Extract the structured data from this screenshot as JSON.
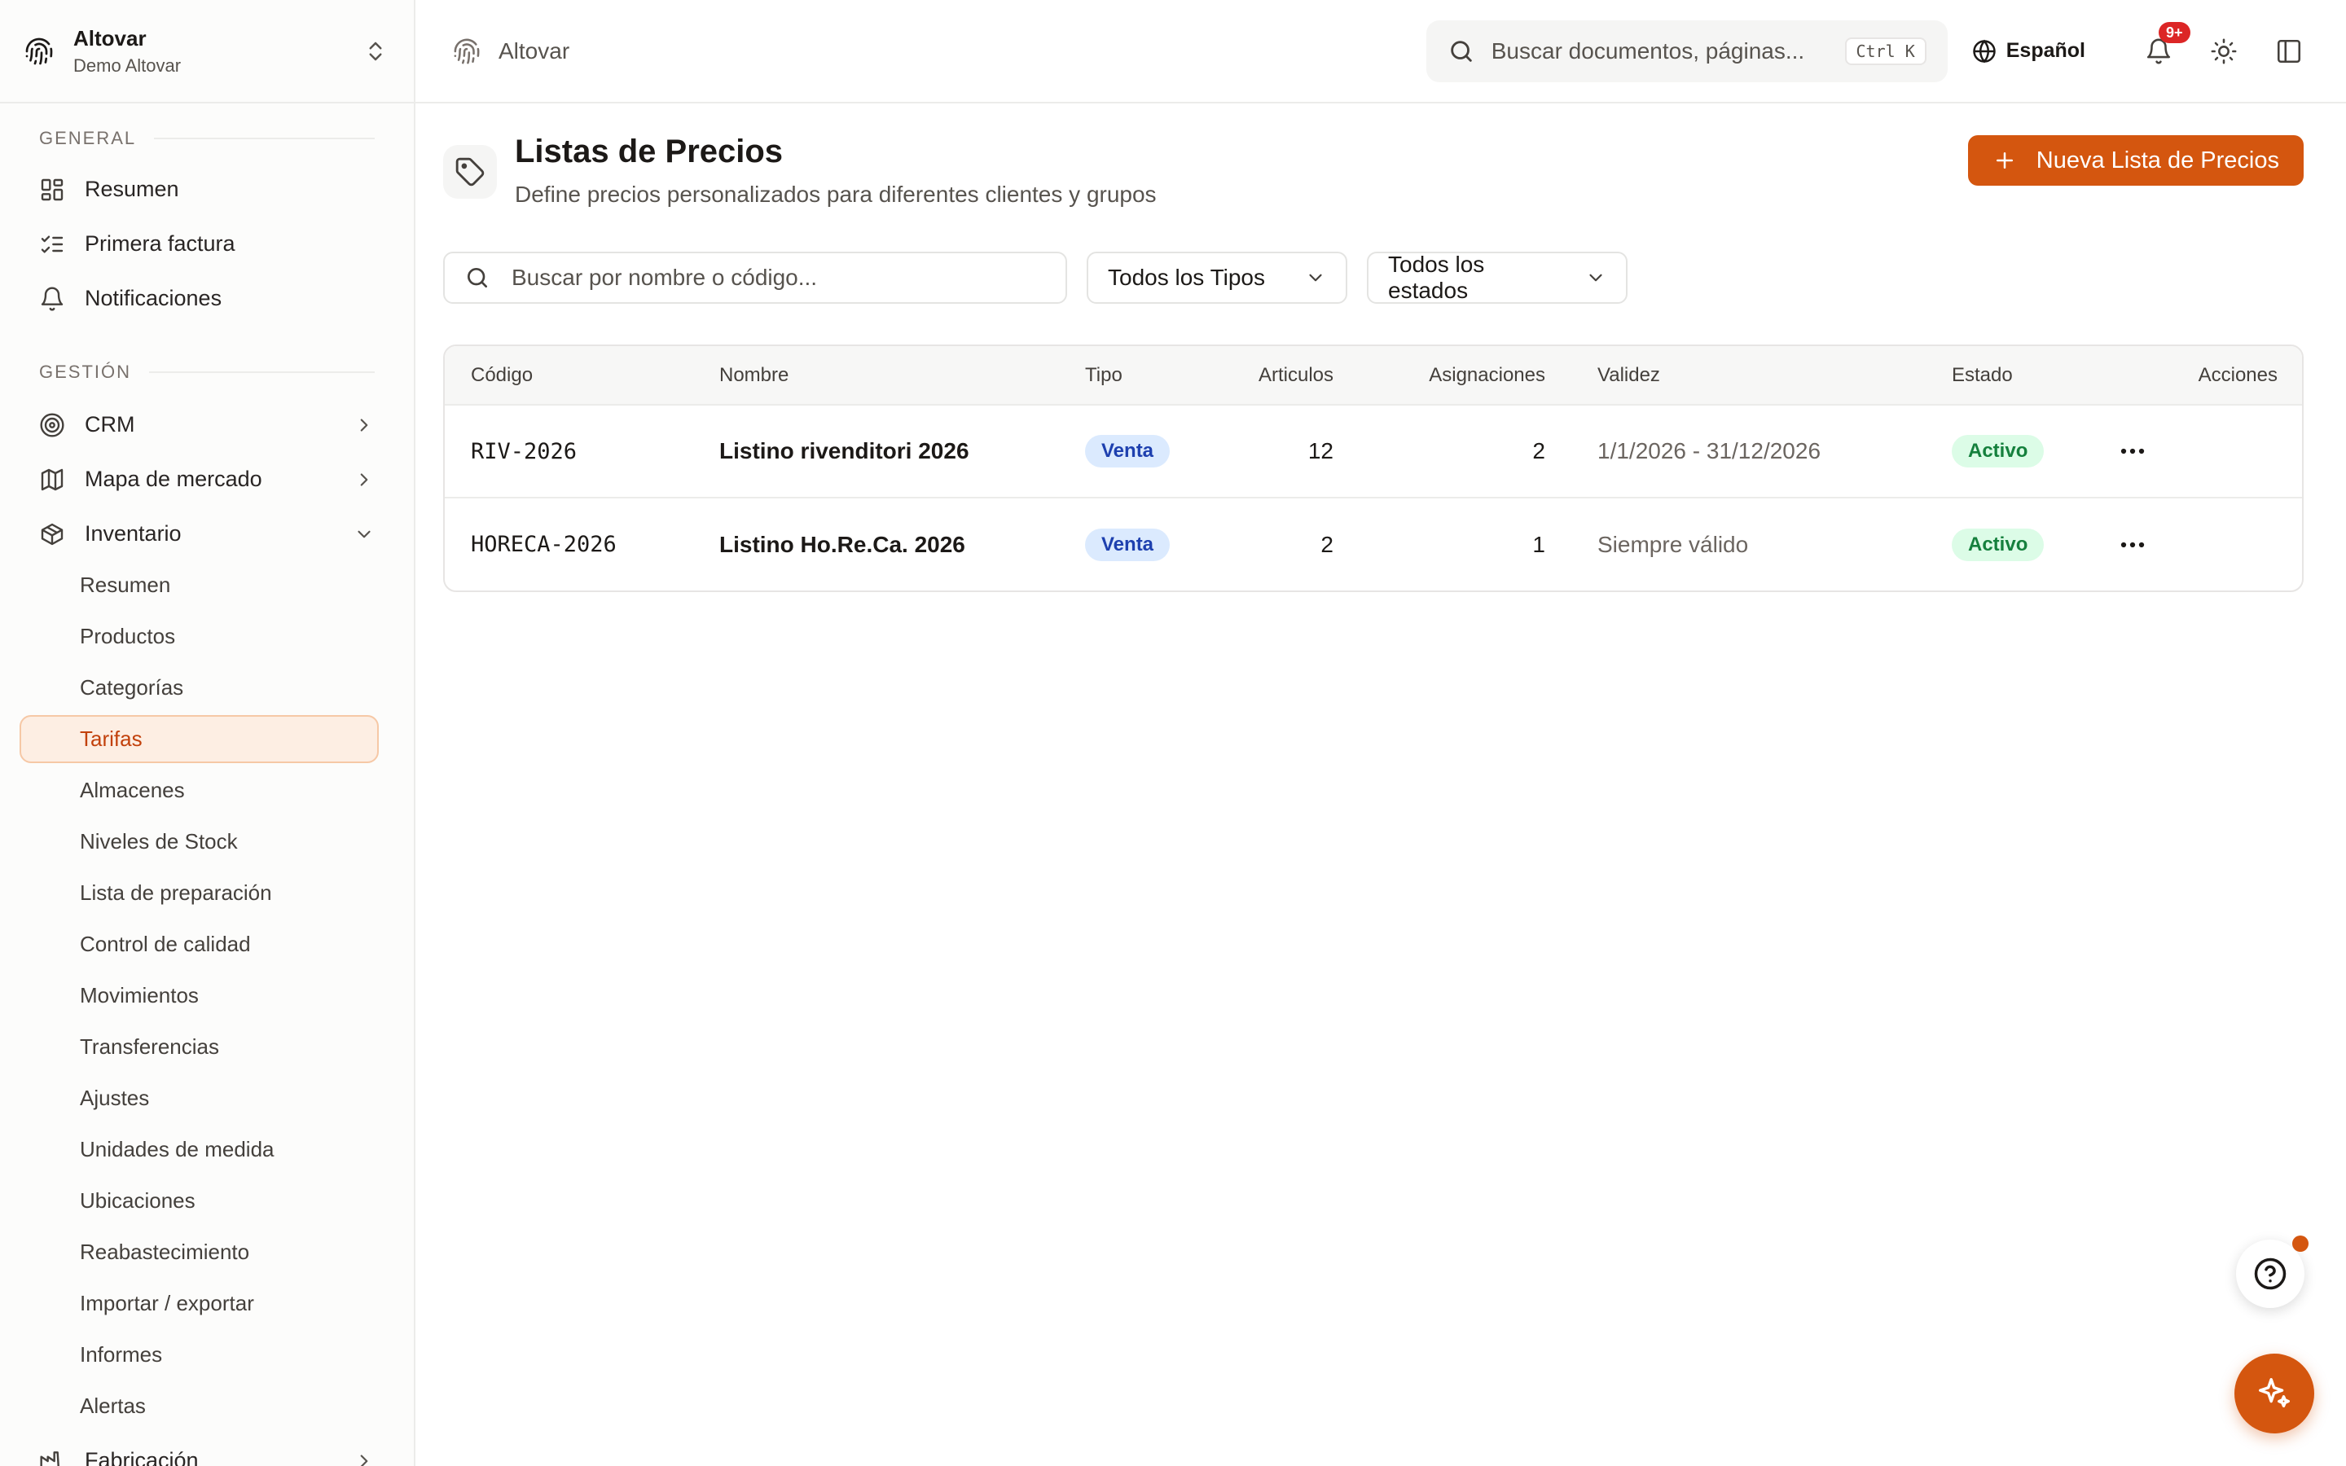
{
  "org": {
    "name": "Altovar",
    "subtitle": "Demo Altovar"
  },
  "sidebar": {
    "sections": [
      {
        "label": "GENERAL",
        "items": [
          {
            "label": "Resumen",
            "icon": "dashboard-icon"
          },
          {
            "label": "Primera factura",
            "icon": "checklist-icon"
          },
          {
            "label": "Notificaciones",
            "icon": "bell-icon"
          }
        ]
      },
      {
        "label": "GESTIÓN",
        "items": [
          {
            "label": "CRM",
            "icon": "target-icon",
            "expandable": true
          },
          {
            "label": "Mapa de mercado",
            "icon": "map-icon",
            "expandable": true
          },
          {
            "label": "Inventario",
            "icon": "box-icon",
            "expanded": true
          }
        ],
        "inventory_children": [
          "Resumen",
          "Productos",
          "Categorías",
          "Tarifas",
          "Almacenes",
          "Niveles de Stock",
          "Lista de preparación",
          "Control de calidad",
          "Movimientos",
          "Transferencias",
          "Ajustes",
          "Unidades de medida",
          "Ubicaciones",
          "Reabastecimiento",
          "Importar / exportar",
          "Informes",
          "Alertas"
        ],
        "active_child": "Tarifas",
        "trailing_item": {
          "label": "Fabricación",
          "icon": "factory-icon"
        }
      }
    ]
  },
  "topbar": {
    "breadcrumb": "Altovar",
    "search_placeholder": "Buscar documentos, páginas...",
    "search_shortcut": "Ctrl K",
    "language": "Español",
    "notifications_badge": "9+"
  },
  "page": {
    "title": "Listas de Precios",
    "subtitle": "Define precios personalizados para diferentes clientes y grupos",
    "new_button": "Nueva Lista de Precios",
    "filter_search_placeholder": "Buscar por nombre o código...",
    "type_filter": "Todos los Tipos",
    "status_filter": "Todos los estados"
  },
  "table": {
    "columns": [
      "Código",
      "Nombre",
      "Tipo",
      "Articulos",
      "Asignaciones",
      "Validez",
      "Estado",
      "Acciones"
    ],
    "rows": [
      {
        "code": "RIV-2026",
        "name": "Listino rivenditori 2026",
        "type": "Venta",
        "items": "12",
        "assignments": "2",
        "validity": "1/1/2026 - 31/12/2026",
        "status": "Activo"
      },
      {
        "code": "HORECA-2026",
        "name": "Listino Ho.Re.Ca. 2026",
        "type": "Venta",
        "items": "2",
        "assignments": "1",
        "validity": "Siempre válido",
        "status": "Activo"
      }
    ]
  },
  "colors": {
    "accent": "#d4560f",
    "active_bg": "#fdeee3",
    "type_pill": "#dbeafe",
    "status_pill": "#dcfce7"
  }
}
